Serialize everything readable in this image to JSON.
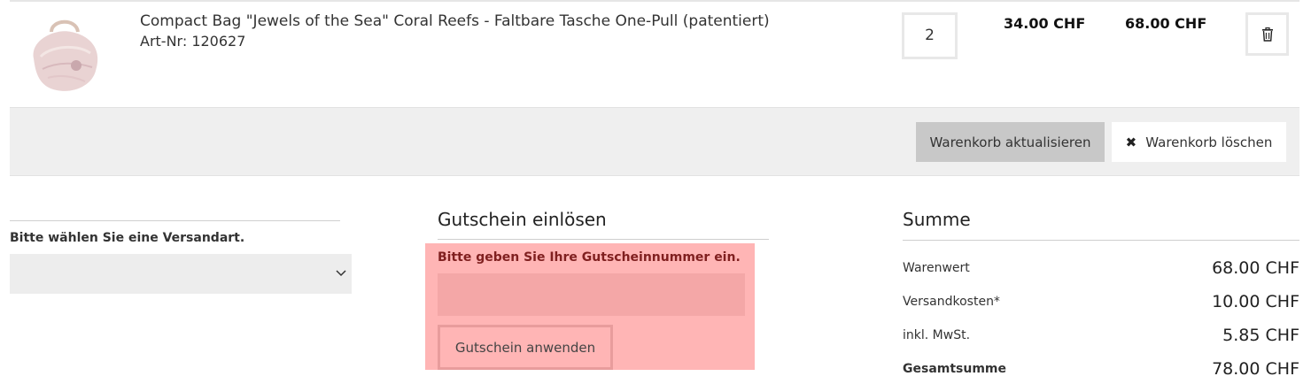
{
  "product": {
    "name": "Compact Bag \"Jewels of the Sea\" Coral Reefs - Faltbare Tasche One-Pull (patentiert)",
    "sku": "Art-Nr: 120627",
    "quantity": "2",
    "unit_price": "34.00 CHF",
    "total_price": "68.00 CHF",
    "image_icon": "bag-product-image"
  },
  "actions": {
    "update_label": "Warenkorb aktualisieren",
    "clear_label": "Warenkorb löschen",
    "clear_icon": "close-icon"
  },
  "shipping": {
    "label": "Bitte wählen Sie eine Versandart.",
    "selected": ""
  },
  "coupon": {
    "title": "Gutschein einlösen",
    "hint": "Bitte geben Sie Ihre Gutscheinnummer ein.",
    "input_value": "",
    "button_label": "Gutschein anwenden",
    "highlight_color": "#ffb5b5"
  },
  "summary": {
    "title": "Summe",
    "rows": [
      {
        "label": "Warenwert",
        "value": "68.00 CHF"
      },
      {
        "label": "Versandkosten*",
        "value": "10.00 CHF"
      },
      {
        "label": "inkl. MwSt.",
        "value": "5.85 CHF"
      },
      {
        "label": "Gesamtsumme",
        "value": "78.00 CHF"
      }
    ]
  }
}
